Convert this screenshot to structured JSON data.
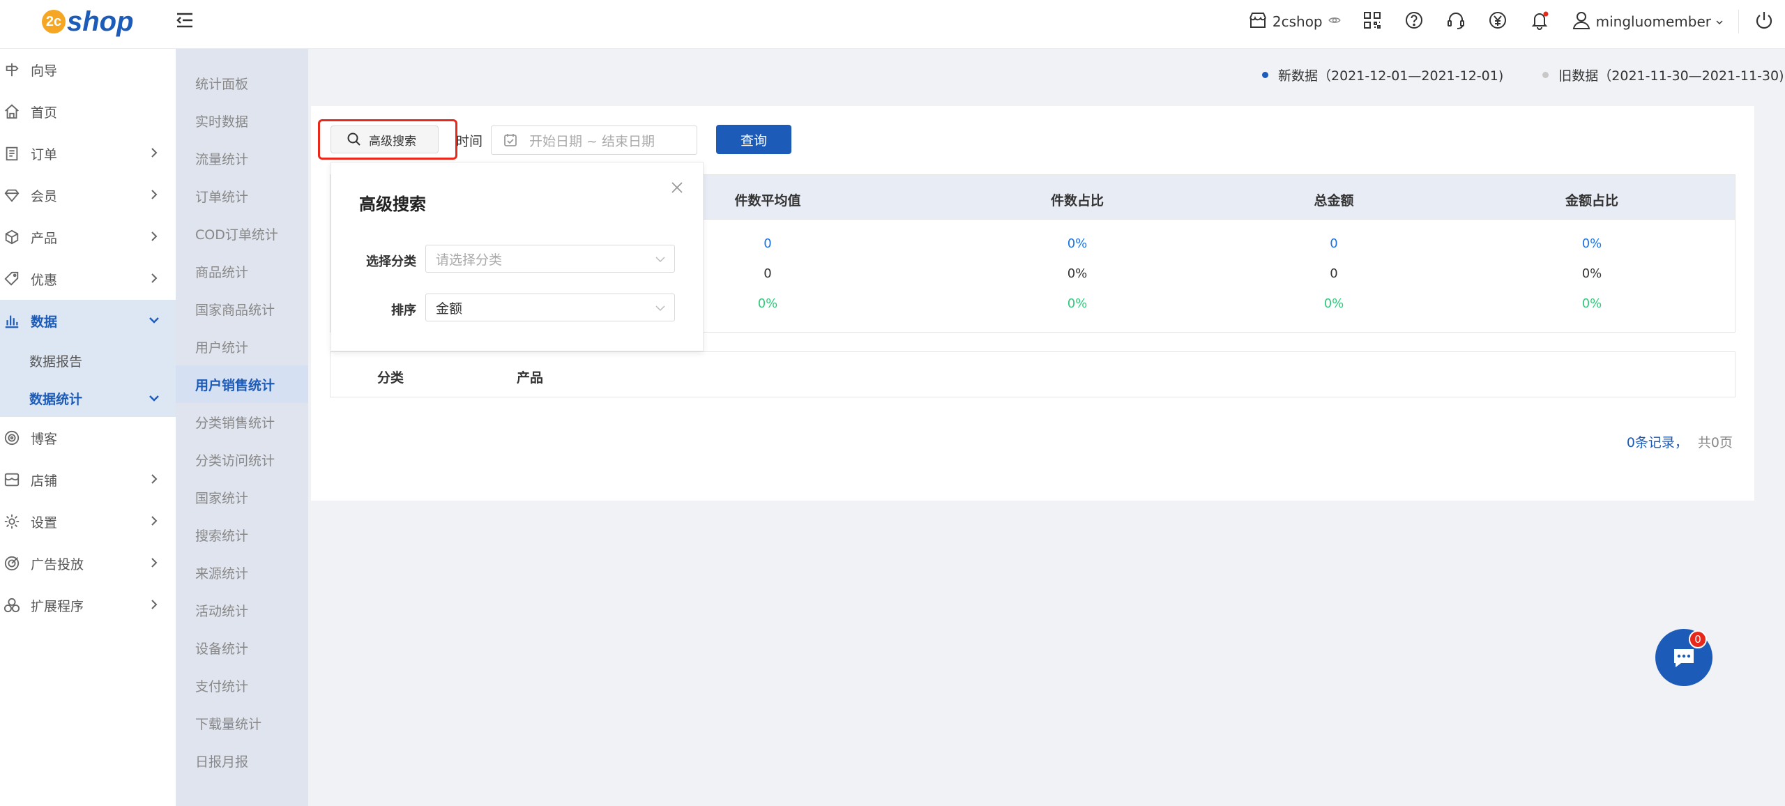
{
  "brand": {
    "logo_mark": "2c",
    "logo_text": "shop"
  },
  "topbar": {
    "store_name": "2cshop",
    "username": "mingluomember"
  },
  "sidebar": {
    "items": [
      {
        "label": "向导",
        "icon": "guide-icon",
        "chevron": false
      },
      {
        "label": "首页",
        "icon": "home-icon",
        "chevron": false
      },
      {
        "label": "订单",
        "icon": "order-icon",
        "chevron": true
      },
      {
        "label": "会员",
        "icon": "member-icon",
        "chevron": true
      },
      {
        "label": "产品",
        "icon": "product-icon",
        "chevron": true
      },
      {
        "label": "优惠",
        "icon": "coupon-icon",
        "chevron": true
      },
      {
        "label": "数据",
        "icon": "data-icon",
        "chevron": true
      },
      {
        "label": "博客",
        "icon": "blog-icon",
        "chevron": false
      },
      {
        "label": "店铺",
        "icon": "store-icon",
        "chevron": true
      },
      {
        "label": "设置",
        "icon": "settings-icon",
        "chevron": true
      },
      {
        "label": "广告投放",
        "icon": "ads-icon",
        "chevron": true
      },
      {
        "label": "扩展程序",
        "icon": "extension-icon",
        "chevron": true
      }
    ],
    "data_sub": [
      "数据报告",
      "数据统计"
    ]
  },
  "submenu": [
    "统计面板",
    "实时数据",
    "流量统计",
    "订单统计",
    "COD订单统计",
    "商品统计",
    "国家商品统计",
    "用户统计",
    "用户销售统计",
    "分类销售统计",
    "分类访问统计",
    "国家统计",
    "搜索统计",
    "来源统计",
    "活动统计",
    "设备统计",
    "支付统计",
    "下载量统计",
    "日报月报"
  ],
  "legend": {
    "new_label": "新数据（2021-12-01—2021-12-01)",
    "old_label": "旧数据（2021-11-30—2021-11-30)",
    "new_color": "#1c5bb8",
    "old_color": "#c8c8c8"
  },
  "filters": {
    "advanced_search": "高级搜索",
    "time_label": "时间",
    "date_placeholder": "开始日期 ~ 结束日期",
    "query": "查询"
  },
  "stats_table": {
    "headers": [
      "件数平均值",
      "件数占比",
      "总金额",
      "金额占比"
    ],
    "rows": [
      {
        "values": [
          "0",
          "0%",
          "0",
          "0%"
        ],
        "color": "#1a73e8"
      },
      {
        "values": [
          "0",
          "0%",
          "0",
          "0%"
        ],
        "color": "#333333"
      },
      {
        "values": [
          "0%",
          "0%",
          "0%",
          "0%"
        ],
        "color": "#2ec97a"
      }
    ]
  },
  "list_table": {
    "headers": [
      "分类",
      "产品"
    ]
  },
  "pager": {
    "records": "0条记录，",
    "pages": "共0页"
  },
  "popup": {
    "title": "高级搜索",
    "category_label": "选择分类",
    "category_placeholder": "请选择分类",
    "sort_label": "排序",
    "sort_value": "金额"
  },
  "chat": {
    "badge": "0"
  }
}
